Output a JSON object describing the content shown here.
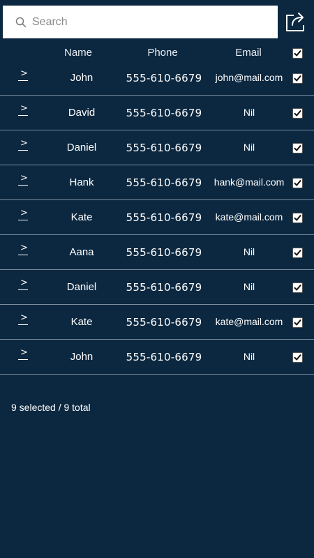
{
  "search": {
    "placeholder": "Search"
  },
  "icons": {
    "search": "search-icon",
    "share": "share-icon",
    "expand": "chevron-right-icon",
    "check": "checkmark-icon"
  },
  "colors": {
    "background": "#0c2840",
    "search_bg": "#ffffff",
    "divider": "#7c8d9d",
    "text": "#ffffff"
  },
  "table": {
    "columns": {
      "name": "Name",
      "phone": "Phone",
      "email": "Email"
    },
    "select_all_checked": true,
    "rows": [
      {
        "name": "John",
        "phone": "555-610-6679",
        "email": "john@mail.com",
        "checked": true
      },
      {
        "name": "David",
        "phone": "555-610-6679",
        "email": "Nil",
        "checked": true
      },
      {
        "name": "Daniel",
        "phone": "555-610-6679",
        "email": "Nil",
        "checked": true
      },
      {
        "name": "Hank",
        "phone": "555-610-6679",
        "email": "hank@mail.com",
        "checked": true
      },
      {
        "name": "Kate",
        "phone": "555-610-6679",
        "email": "kate@mail.com",
        "checked": true
      },
      {
        "name": "Aana",
        "phone": "555-610-6679",
        "email": "Nil",
        "checked": true
      },
      {
        "name": "Daniel",
        "phone": "555-610-6679",
        "email": "Nil",
        "checked": true
      },
      {
        "name": "Kate",
        "phone": "555-610-6679",
        "email": "kate@mail.com",
        "checked": true
      },
      {
        "name": "John",
        "phone": "555-610-6679",
        "email": "Nil",
        "checked": true
      }
    ]
  },
  "summary": {
    "text": "9 selected / 9 total"
  }
}
